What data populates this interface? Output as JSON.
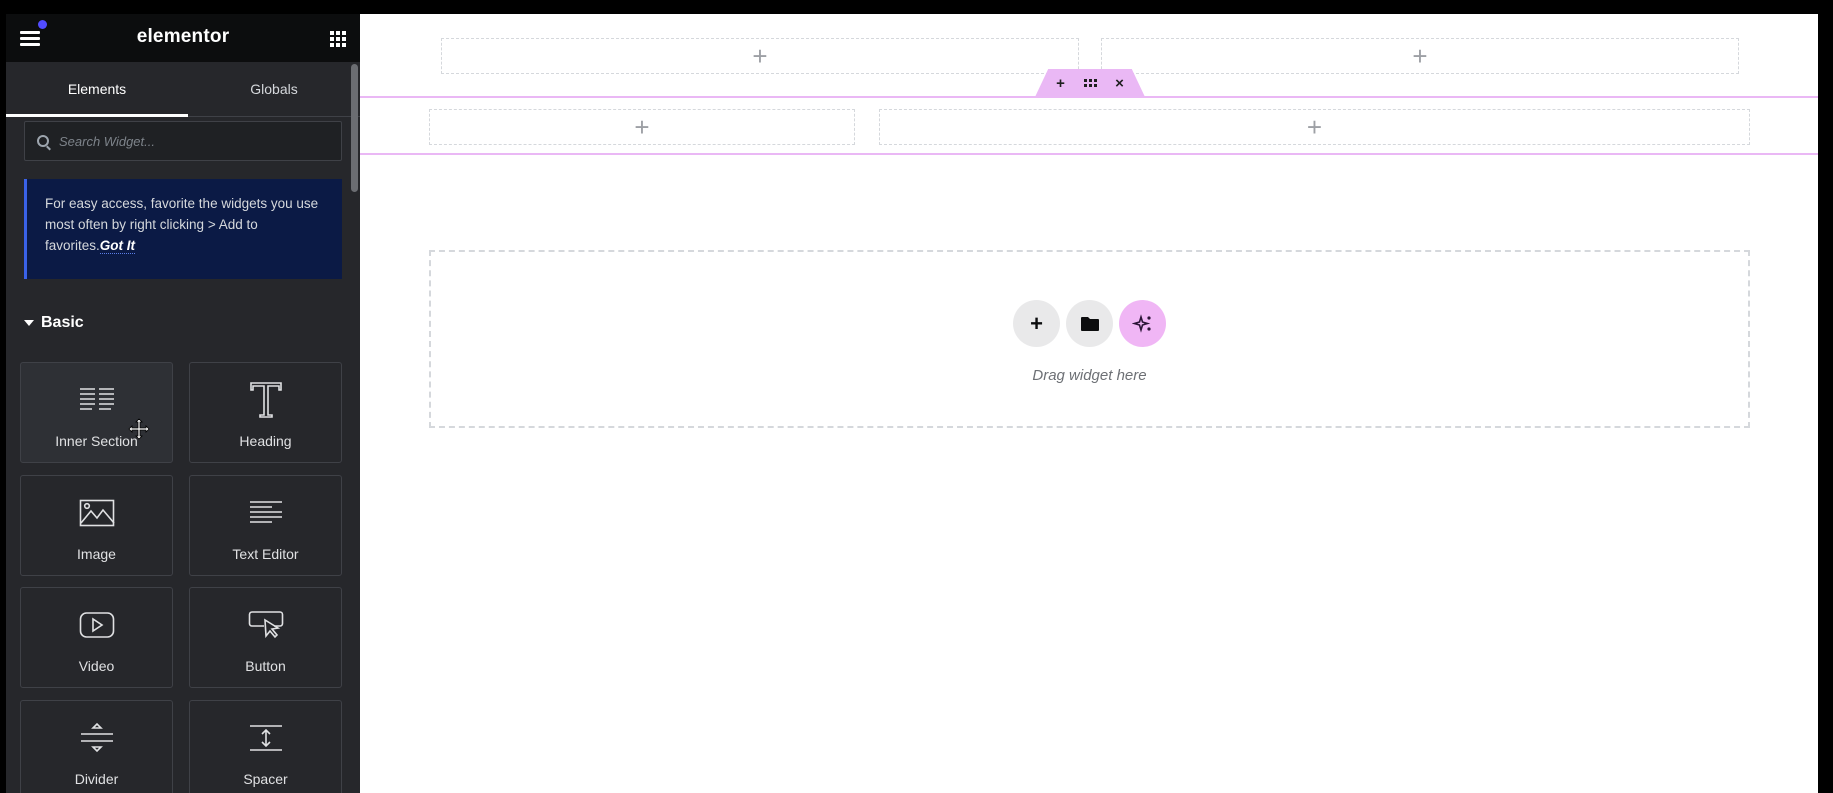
{
  "header": {
    "logo": "elementor",
    "menu_icon": "hamburger-icon",
    "apps_icon": "apps-grid-icon"
  },
  "tabs": [
    {
      "label": "Elements",
      "active": true
    },
    {
      "label": "Globals",
      "active": false
    }
  ],
  "search": {
    "placeholder": "Search Widget...",
    "value": ""
  },
  "notice": {
    "text": "For easy access, favorite the widgets you use most often by right clicking > Add to favorites.",
    "link": "Got It"
  },
  "category": {
    "label": "Basic",
    "expanded": true
  },
  "widgets": [
    {
      "label": "Inner Section",
      "icon": "inner-section-icon"
    },
    {
      "label": "Heading",
      "icon": "heading-icon"
    },
    {
      "label": "Image",
      "icon": "image-icon"
    },
    {
      "label": "Text Editor",
      "icon": "text-editor-icon"
    },
    {
      "label": "Video",
      "icon": "video-icon"
    },
    {
      "label": "Button",
      "icon": "button-icon"
    },
    {
      "label": "Divider",
      "icon": "divider-icon"
    },
    {
      "label": "Spacer",
      "icon": "spacer-icon"
    }
  ],
  "canvas": {
    "add_symbol": "+",
    "section_handle": {
      "add": "+",
      "close": "×"
    },
    "drop_zone": {
      "text": "Drag widget here",
      "add": "+"
    }
  },
  "colors": {
    "accent_pink": "#eab8f5",
    "notice_bg": "#0b1a45",
    "notification_dot": "#524cff",
    "sidebar_bg": "#26272b"
  }
}
